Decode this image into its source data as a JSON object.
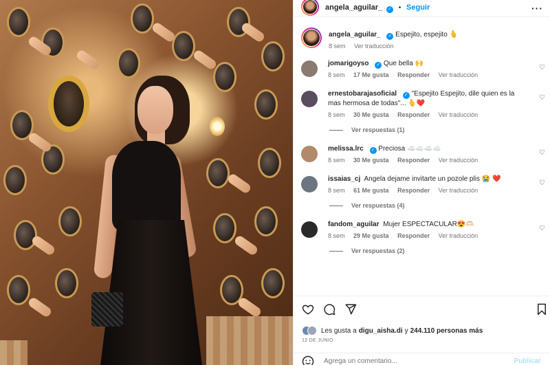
{
  "header": {
    "username": "angela_aguilar_",
    "separator": "•",
    "follow_label": "Seguir",
    "more_icon": "more-icon"
  },
  "caption": {
    "username": "angela_aguilar_",
    "text": "Espejito, espejito 🫰",
    "time": "8 sem",
    "translate": "Ver traducción"
  },
  "comments": [
    {
      "username": "jomarigoyso",
      "verified": true,
      "text": "Que bella 🙌",
      "time": "8 sem",
      "likes": "17 Me gusta",
      "reply": "Responder",
      "translate": "Ver traducción",
      "replies": "",
      "avatar_color": "#8b7a70"
    },
    {
      "username": "ernestobarajasoficial",
      "verified": true,
      "text": "\"Espejito Espejito, dile quien es la mas hermosa de todas\"... 🫰❤️",
      "time": "8 sem",
      "likes": "30 Me gusta",
      "reply": "Responder",
      "translate": "Ver traducción",
      "replies": "Ver respuestas (1)",
      "avatar_color": "#5a4d60"
    },
    {
      "username": "melissa.lrc",
      "verified": true,
      "text": "Preciosa ☁️☁️☁️☁️",
      "time": "8 sem",
      "likes": "30 Me gusta",
      "reply": "Responder",
      "translate": "Ver traducción",
      "replies": "",
      "avatar_color": "#b08a6a"
    },
    {
      "username": "issaias_cj",
      "verified": false,
      "text": "Angela dejame invitarte un pozole plis 😭 ❤️",
      "time": "8 sem",
      "likes": "61 Me gusta",
      "reply": "Responder",
      "translate": "Ver traducción",
      "replies": "Ver respuestas (4)",
      "avatar_color": "#6d7680"
    },
    {
      "username": "fandom_aguilar",
      "verified": false,
      "text": "Mujer ESPECTACULAR😍🫶🏻",
      "time": "8 sem",
      "likes": "29 Me gusta",
      "reply": "Responder",
      "translate": "Ver traducción",
      "replies": "Ver respuestas (2)",
      "avatar_color": "#2a2a2a"
    }
  ],
  "actions": {
    "like_icon": "heart-icon",
    "comment_icon": "comment-icon",
    "share_icon": "share-icon",
    "save_icon": "bookmark-icon"
  },
  "likes": {
    "prefix": "Les gusta a",
    "user": "digu_aisha.di",
    "middle": "y",
    "count": "244.110 personas más"
  },
  "date": "12 DE JUNIO",
  "add_comment": {
    "placeholder": "Agrega un comentario...",
    "post_label": "Publicar",
    "emoji_icon": "emoji-icon"
  },
  "colors": {
    "accent": "#0095f6",
    "secondary_text": "#737373",
    "heart_red": "#ed4956"
  }
}
